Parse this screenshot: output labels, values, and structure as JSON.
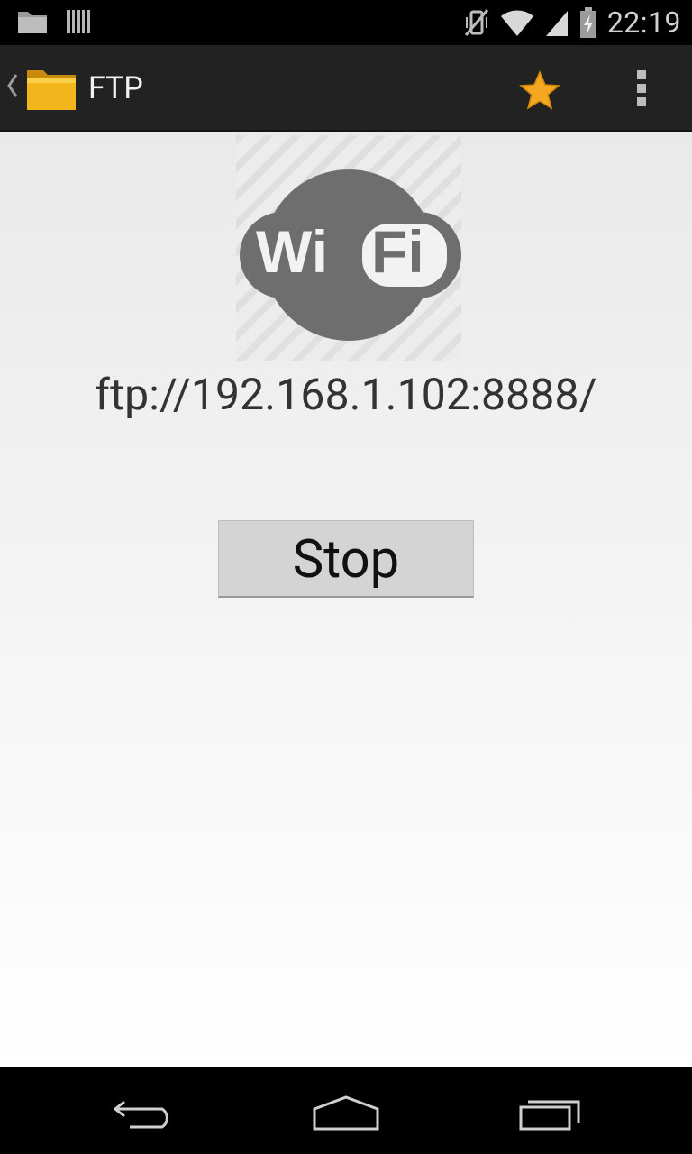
{
  "status_bar": {
    "time": "22:19",
    "icons": [
      "folder-notification-icon",
      "barcode-notification-icon",
      "vibrate-mute-icon",
      "wifi-signal-icon",
      "cell-signal-icon",
      "battery-charging-icon"
    ]
  },
  "action_bar": {
    "title": "FTP",
    "icons": [
      "up-caret-icon",
      "folder-app-icon",
      "star-icon",
      "overflow-menu-icon"
    ],
    "accent_color": "#f5a623"
  },
  "main": {
    "ftp_address": "ftp://192.168.1.102:8888/",
    "stop_label": "Stop",
    "logo": {
      "left_text": "Wi",
      "right_text": "Fi"
    }
  },
  "nav_bar": {
    "icons": [
      "back-icon",
      "home-icon",
      "recents-icon"
    ]
  }
}
